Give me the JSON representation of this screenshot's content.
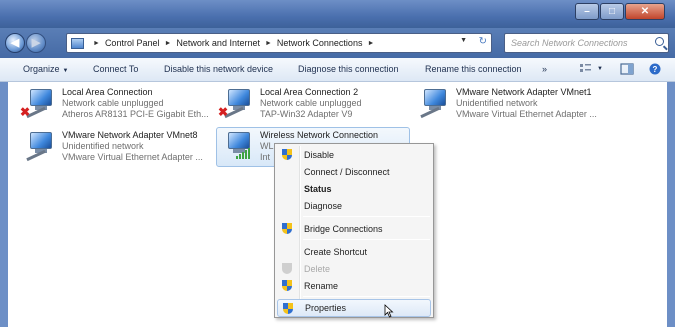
{
  "window": {
    "controls": {
      "minimize": "–",
      "maximize": "□",
      "close": "✕"
    }
  },
  "address": {
    "back_icon": "arrow-left-icon",
    "forward_icon": "arrow-right-icon",
    "crumbs": [
      "Control Panel",
      "Network and Internet",
      "Network Connections"
    ],
    "separator": "►",
    "dropdown": "▼",
    "refresh": "↻",
    "search_placeholder": "Search Network Connections"
  },
  "toolbar": {
    "organize": "Organize",
    "dd": "▼",
    "connect_to": "Connect To",
    "disable_device": "Disable this network device",
    "diagnose": "Diagnose this connection",
    "rename": "Rename this connection",
    "more": "»"
  },
  "connections": [
    {
      "name": "Local Area Connection",
      "status": "Network cable unplugged",
      "adapter": "Atheros AR8131 PCI-E Gigabit Eth...",
      "icon": "network-unplugged-icon"
    },
    {
      "name": "Local Area Connection 2",
      "status": "Network cable unplugged",
      "adapter": "TAP-Win32 Adapter V9",
      "icon": "network-unplugged-icon"
    },
    {
      "name": "VMware Network Adapter VMnet1",
      "status": "Unidentified network",
      "adapter": "VMware Virtual Ethernet Adapter ...",
      "icon": "network-connected-icon"
    },
    {
      "name": "VMware Network Adapter VMnet8",
      "status": "Unidentified network",
      "adapter": "VMware Virtual Ethernet Adapter ...",
      "icon": "network-connected-icon"
    },
    {
      "name": "Wireless Network Connection",
      "status": "WL",
      "adapter": "Int",
      "icon": "wireless-signal-icon"
    }
  ],
  "context_menu": {
    "disable": "Disable",
    "connect_disconnect": "Connect / Disconnect",
    "status": "Status",
    "diagnose": "Diagnose",
    "bridge": "Bridge Connections",
    "create_shortcut": "Create Shortcut",
    "delete": "Delete",
    "rename": "Rename",
    "properties": "Properties"
  },
  "colors": {
    "titlebar": "#4a6fae",
    "selection": "#d8e8f8",
    "menu_bg": "#f5f5f5",
    "disconnected_x": "#d52020",
    "signal": "#3da340"
  }
}
